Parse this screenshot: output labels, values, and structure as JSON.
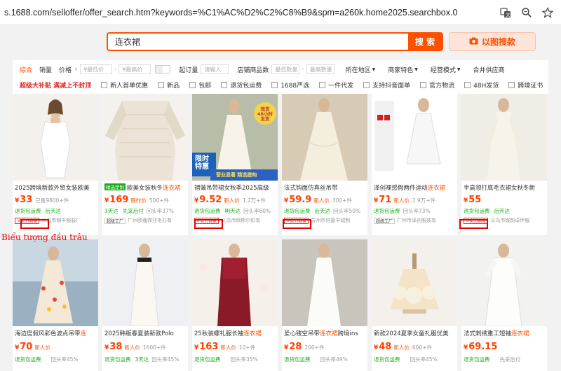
{
  "address_bar": {
    "url": "s.1688.com/selloffer/offer_search.htm?keywords=%C1%AC%D2%C2%C8%B9&spm=a260k.home2025.searchbox.0"
  },
  "search": {
    "value": "连衣裙",
    "button": "搜 索",
    "image_search": "以图搜款"
  },
  "filters": {
    "sort": [
      "综合",
      "销量",
      "价格"
    ],
    "price_min": "¥最低价",
    "price_max": "¥最高价",
    "moq_label": "起订量",
    "moq_placeholder": "请输入",
    "shop_goods_label": "店铺商品数",
    "min_qty": "最低数量",
    "max_qty": "最高数量",
    "location": "所在地区",
    "merchant": "商家特色",
    "mode": "经营模式",
    "merge_supplier": "合并供应商",
    "row2_first": "超级大补贴 满减上不封顶",
    "checks": [
      "新人首单优惠",
      "新品",
      "包邮",
      "退货包运费",
      "1688严选",
      "一件代发",
      "支持抖音面单",
      "官方物流",
      "48H发货",
      "跨境证书"
    ]
  },
  "products": [
    {
      "title_pre": "2025跨境新款外贸女装欧美",
      "title_hl": "",
      "tag": "",
      "price": "33",
      "label": "",
      "sold": "已售9800+件",
      "svc1": "退货包运费",
      "svc2": "后天达",
      "rate": "",
      "shop": "义乌市锦丰服装厂",
      "badge": "实力商家"
    },
    {
      "title_pre": "欧美女装秋冬",
      "title_hl": "连衣裙",
      "tag": "精选定制",
      "price": "169",
      "label": "限时价",
      "sold": "500+件",
      "svc1": "3天达",
      "svc2": "先采后付",
      "rate": "回头率37%",
      "shop": "广州欧蔻霏亚毛衫有",
      "badge": "超级工厂"
    },
    {
      "title_pre": "褶皱吊带裙女秋季2025高级",
      "title_hl": "",
      "tag": "",
      "price": "9.52",
      "label": "新人价",
      "sold": "1.2万+件",
      "svc1": "退货包运费",
      "svc2": "明天达",
      "rate": "回头率60%",
      "shop": "义乌市倾斯尔织有",
      "badge": "实力商家"
    },
    {
      "title_pre": "法式钩面仿真丝吊带",
      "title_hl": "",
      "tag": "",
      "price": "59.9",
      "label": "新人价",
      "sold": "300+件",
      "svc1": "退货包运费",
      "svc2": "后天达",
      "rate": "回头率50%",
      "shop": "苏州市倍嘉羊绒制",
      "badge": "实力商家"
    },
    {
      "title_pre": "泽创裸感假两件运动",
      "title_hl": "连衣裙",
      "tag": "",
      "price": "71",
      "label": "新人价",
      "sold": "2.9万+件",
      "svc1": "退货包运费",
      "svc2": "",
      "rate": "回头率73%",
      "shop": "广州市泽创服装有",
      "badge": "超级工厂"
    },
    {
      "title_pre": "半高领打底毛衣裙女秋冬新",
      "title_hl": "",
      "tag": "",
      "price": "55",
      "label": "",
      "sold": "",
      "svc1": "退货包运费",
      "svc2": "后天达",
      "rate": "",
      "shop": "义乌市蝶韵卓伊服",
      "badge": "实力商家"
    },
    {
      "title_pre": "海边度假风彩色波点吊带",
      "title_hl": "连",
      "tag": "",
      "price": "70",
      "label": "新人价",
      "sold": "",
      "svc1": "退货包运费",
      "svc2": "",
      "rate": "回头率45%",
      "shop": "",
      "badge": ""
    },
    {
      "title_pre": "2025韩版春夏装新款Polo",
      "title_hl": "",
      "tag": "",
      "price": "38",
      "label": "新人价",
      "sold": "1600+件",
      "svc1": "退货包运费",
      "svc2": "3天达",
      "rate": "回头率45%",
      "shop": "",
      "badge": ""
    },
    {
      "title_pre": "25秋装螺礼服长袖",
      "title_hl": "连衣裙",
      "tag": "",
      "price": "163",
      "label": "新人价",
      "sold": "10+件",
      "svc1": "退货包运费",
      "svc2": "",
      "rate": "回头率35%",
      "shop": "",
      "badge": ""
    },
    {
      "title_pre": "爱心镂空吊带",
      "title_hl": "连衣裙",
      "tag": "",
      "price": "28",
      "label": "",
      "sold": "200+件",
      "svc1": "退货包运费",
      "svc2": "",
      "rate": "回头率49%",
      "shop": "",
      "badge": ""
    },
    {
      "title_pre": "新款2024夏季女童礼服优美",
      "title_hl": "",
      "tag": "",
      "price": "48",
      "label": "新人价",
      "sold": "600+件",
      "svc1": "退货包运费",
      "svc2": "",
      "rate": "回头率45%",
      "shop": "",
      "badge": ""
    },
    {
      "title_pre": "法式刺绣重工短袖",
      "title_hl": "连衣裙",
      "tag": "",
      "price": "69.15",
      "label": "",
      "sold": "",
      "svc1": "退货包运费",
      "svc2": "",
      "rate": "先采后付",
      "shop": "",
      "badge": ""
    }
  ],
  "overlay_text": {
    "limit": "限时\n特惠",
    "promo": "现货\n48小时\n发货",
    "dept": "营业显著 精选建构"
  },
  "annotation": "Biểu tượng đầu trâu",
  "colors": {
    "accent": "#ff5000",
    "highlight_box": "#e60000"
  }
}
